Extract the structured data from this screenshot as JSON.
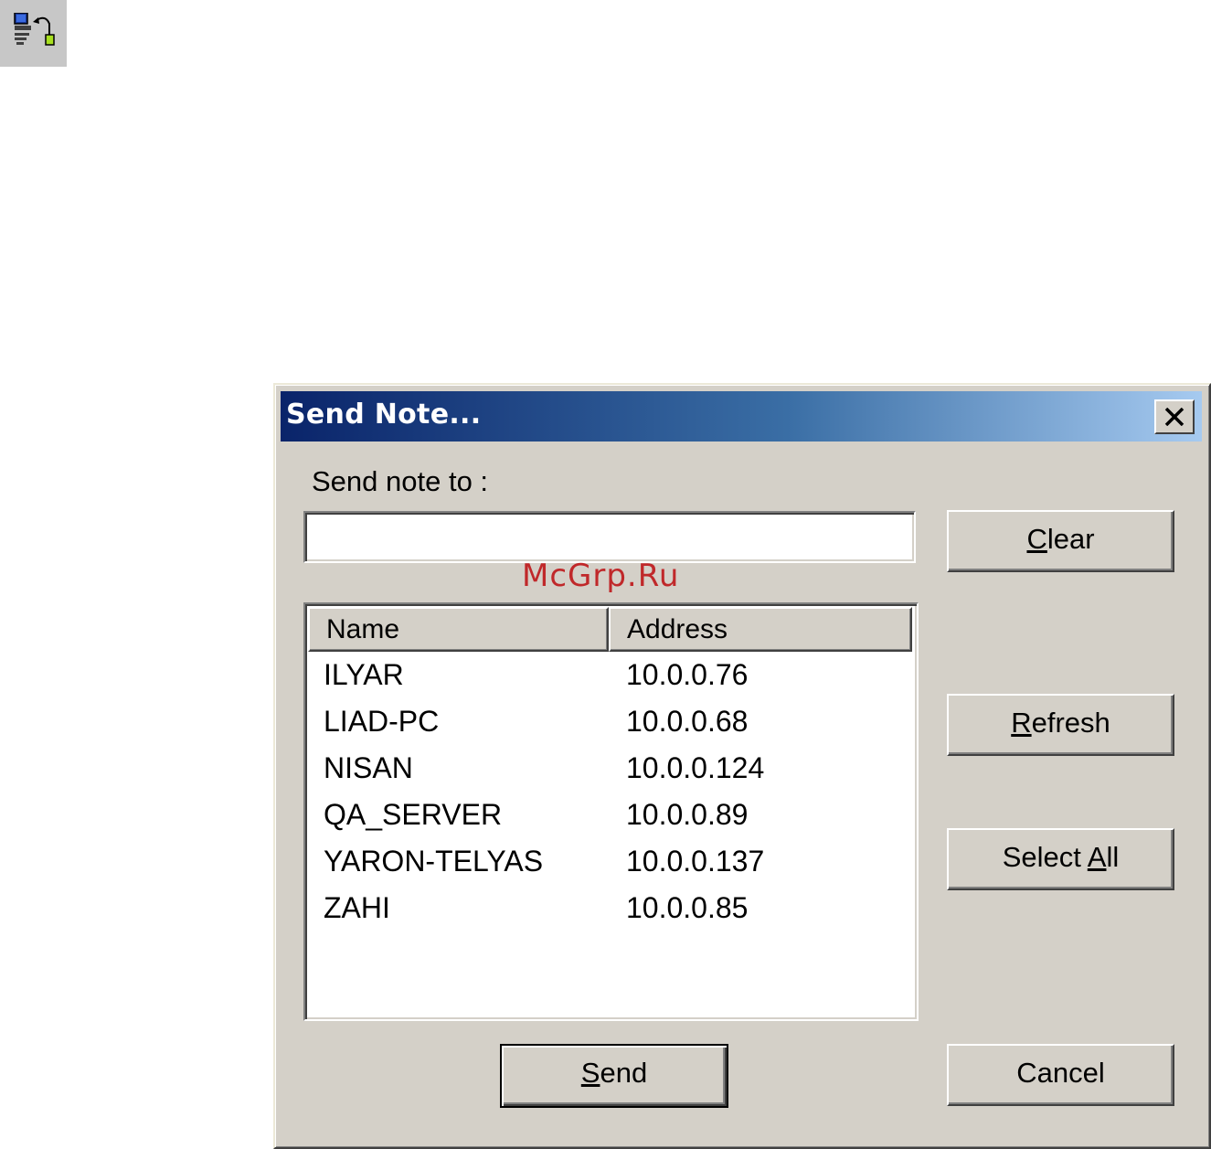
{
  "toolbar": {
    "icon": "network-note-icon"
  },
  "dialog": {
    "title": "Send Note...",
    "send_to_label": "Send note to :",
    "send_to_value": "",
    "list": {
      "columns": [
        "Name",
        "Address"
      ],
      "rows": [
        {
          "name": "ILYAR",
          "address": "10.0.0.76"
        },
        {
          "name": "LIAD-PC",
          "address": "10.0.0.68"
        },
        {
          "name": "NISAN",
          "address": "10.0.0.124"
        },
        {
          "name": "QA_SERVER",
          "address": "10.0.0.89"
        },
        {
          "name": "YARON-TELYAS",
          "address": "10.0.0.137"
        },
        {
          "name": "ZAHI",
          "address": "10.0.0.85"
        }
      ]
    },
    "buttons": {
      "clear": {
        "pre": "",
        "accel": "C",
        "post": "lear"
      },
      "refresh": {
        "pre": "",
        "accel": "R",
        "post": "efresh"
      },
      "select_all": {
        "pre": "Select ",
        "accel": "A",
        "post": "ll"
      },
      "send": {
        "pre": "",
        "accel": "S",
        "post": "end"
      },
      "cancel": {
        "pre": "Cancel",
        "accel": "",
        "post": ""
      }
    }
  },
  "watermark": "McGrp.Ru",
  "colors": {
    "titlebar_start": "#0a246a",
    "titlebar_end": "#a6caf0",
    "face": "#d4d0c8",
    "watermark": "#c0282a"
  }
}
